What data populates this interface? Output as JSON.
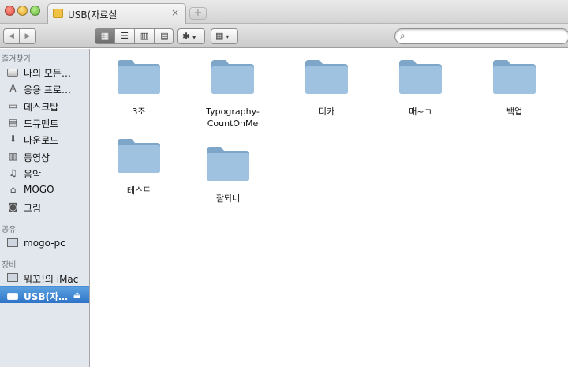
{
  "window": {
    "tab_title": "USB(자료실",
    "tab_close": "×",
    "new_tab": "+"
  },
  "toolbar": {
    "back_icon": "◀",
    "forward_icon": "▶",
    "view_icons": [
      "▦",
      "☰",
      "▥",
      "▤"
    ],
    "action_icon": "✱",
    "arrange_icon": "▦",
    "caret": "▾"
  },
  "search": {
    "placeholder": "",
    "icon": "⌕"
  },
  "sidebar": {
    "favorites_header": "즐겨찾기",
    "favorites": [
      {
        "label": "나의 모든…",
        "icon": "all-files-icon"
      },
      {
        "label": "응용 프로…",
        "icon": "applications-icon"
      },
      {
        "label": "데스크탑",
        "icon": "desktop-icon"
      },
      {
        "label": "도큐멘트",
        "icon": "documents-icon"
      },
      {
        "label": "다운로드",
        "icon": "downloads-icon"
      },
      {
        "label": "동영상",
        "icon": "movies-icon"
      },
      {
        "label": "음악",
        "icon": "music-icon"
      },
      {
        "label": "MOGO",
        "icon": "home-icon"
      },
      {
        "label": "그림",
        "icon": "pictures-icon"
      }
    ],
    "shared_header": "공유",
    "shared": [
      {
        "label": "mogo-pc",
        "icon": "network-computer-icon"
      }
    ],
    "devices_header": "장비",
    "devices": [
      {
        "label": "뭐꼬!의 iMac",
        "icon": "imac-icon"
      },
      {
        "label": "USB(자…",
        "icon": "usb-drive-icon",
        "selected": true,
        "eject": "⏏"
      }
    ]
  },
  "folders": [
    {
      "name": "3조"
    },
    {
      "name": "Typography-\nCountOnMe"
    },
    {
      "name": "디카"
    },
    {
      "name": "매~ㄱ"
    },
    {
      "name": "백업"
    },
    {
      "name": "테스트"
    },
    {
      "name": "잘되네"
    }
  ],
  "colors": {
    "sidebar_bg": "#e2e7ed",
    "selection": "#2f74c8",
    "folder_blue": "#8fb6d8"
  }
}
